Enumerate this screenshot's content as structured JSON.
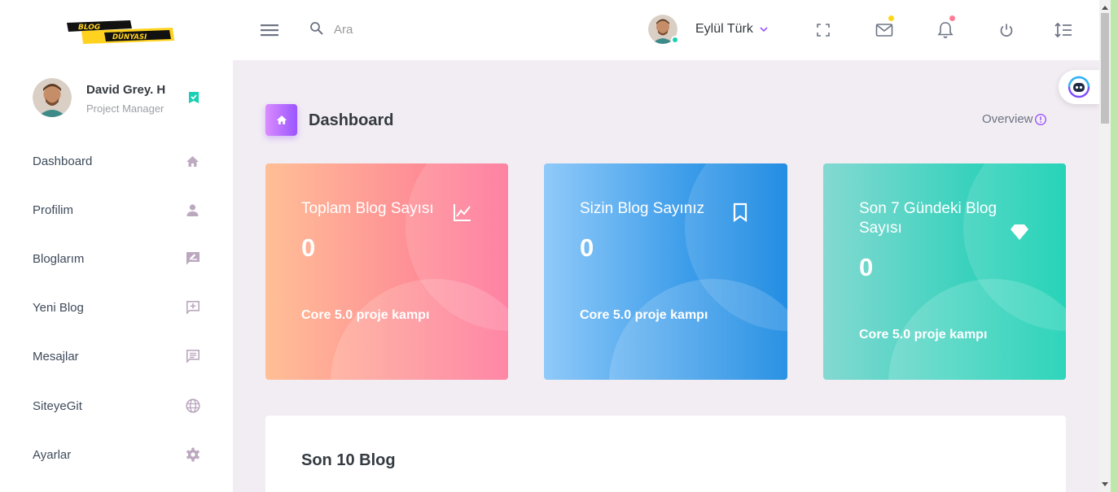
{
  "brand": {
    "logo_line1": "BLOG",
    "logo_line2": "DÜNYASI"
  },
  "search": {
    "placeholder": "Ara"
  },
  "nav_profile": {
    "name": "Eylül Türk"
  },
  "nav_icons": [
    "fullscreen-icon",
    "mail-icon",
    "bell-icon",
    "power-icon",
    "list-settings-icon"
  ],
  "sidebar": {
    "profile": {
      "name": "David Grey. H",
      "role": "Project Manager"
    },
    "items": [
      {
        "label": "Dashboard",
        "icon": "home-icon"
      },
      {
        "label": "Profilim",
        "icon": "user-icon"
      },
      {
        "label": "Bloglarım",
        "icon": "edit-message-icon"
      },
      {
        "label": "Yeni Blog",
        "icon": "add-message-icon"
      },
      {
        "label": "Mesajlar",
        "icon": "message-icon"
      },
      {
        "label": "SiteyeGit",
        "icon": "globe-icon"
      },
      {
        "label": "Ayarlar",
        "icon": "gear-icon"
      }
    ]
  },
  "page": {
    "title": "Dashboard",
    "overview": "Overview"
  },
  "cards": [
    {
      "title": "Toplam Blog Sayısı",
      "value": "0",
      "subtitle": "Core 5.0 proje kampı",
      "icon": "chart-line-icon"
    },
    {
      "title": "Sizin Blog Sayınız",
      "value": "0",
      "subtitle": "Core 5.0 proje kampı",
      "icon": "bookmark-icon"
    },
    {
      "title": "Son 7 Gündeki Blog Sayısı",
      "value": "0",
      "subtitle": "Core 5.0 proje kampı",
      "icon": "diamond-icon"
    }
  ],
  "recent": {
    "title": "Son 10 Blog"
  },
  "colors": {
    "accent": "#9a55ff",
    "online": "#1bcfb4",
    "mail_dot": "#fed713",
    "bell_dot": "#fe7c96"
  }
}
